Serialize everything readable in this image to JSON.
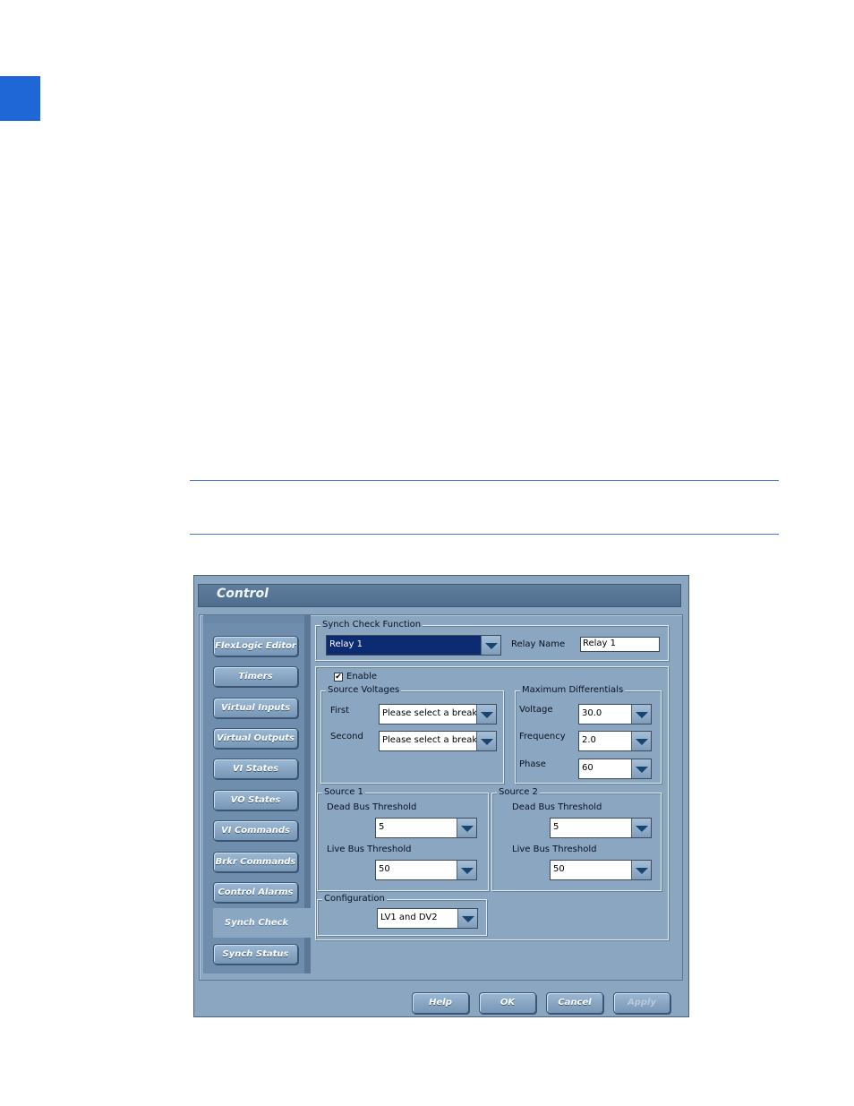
{
  "dialog": {
    "title": "Control",
    "nav": [
      {
        "label": "FlexLogic Editor"
      },
      {
        "label": "Timers"
      },
      {
        "label": "Virtual Inputs"
      },
      {
        "label": "Virtual Outputs"
      },
      {
        "label": "VI States"
      },
      {
        "label": "VO States"
      },
      {
        "label": "VI Commands"
      },
      {
        "label": "Brkr Commands"
      },
      {
        "label": "Control Alarms"
      },
      {
        "label": "Synch Check",
        "active": true
      },
      {
        "label": "Synch Status"
      }
    ],
    "synch_function": {
      "group_label": "Synch Check Function",
      "relay_value": "Relay 1",
      "relay_name_label": "Relay Name",
      "relay_name_value": "Relay 1"
    },
    "enable": {
      "label": "Enable",
      "checked": true,
      "check_glyph": "✔"
    },
    "source_voltages": {
      "group_label": "Source Voltages",
      "first_label": "First",
      "first_value": "Please select a breaker",
      "second_label": "Second",
      "second_value": "Please select a breaker"
    },
    "max_differentials": {
      "group_label": "Maximum Differentials",
      "voltage_label": "Voltage",
      "voltage_value": "30.0",
      "frequency_label": "Frequency",
      "frequency_value": "2.0",
      "phase_label": "Phase",
      "phase_value": "60"
    },
    "source1": {
      "group_label": "Source 1",
      "dead_label": "Dead Bus Threshold",
      "dead_value": "5",
      "live_label": "Live Bus Threshold",
      "live_value": "50"
    },
    "source2": {
      "group_label": "Source 2",
      "dead_label": "Dead Bus Threshold",
      "dead_value": "5",
      "live_label": "Live Bus Threshold",
      "live_value": "50"
    },
    "configuration": {
      "group_label": "Configuration",
      "value": "LV1 and DV2"
    },
    "buttons": {
      "help": "Help",
      "ok": "OK",
      "cancel": "Cancel",
      "apply": "Apply"
    },
    "colors": {
      "page_tab": "#1f66d6",
      "rule": "#4a78c9",
      "dialog_bg": "#8aa6c1",
      "selected_combo": "#0d2b70"
    }
  }
}
